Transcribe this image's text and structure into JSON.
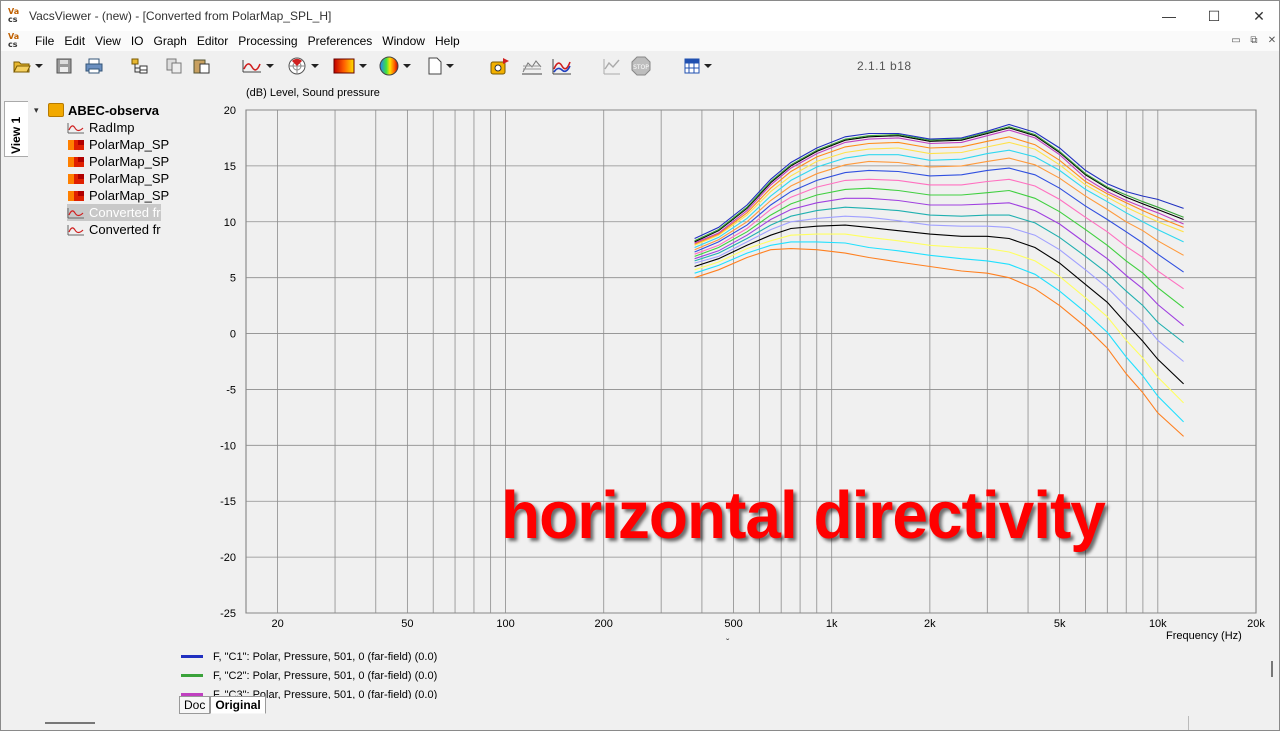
{
  "window": {
    "title": "VacsViewer - (new) - [Converted from PolarMap_SPL_H]",
    "logo_top": "Va",
    "logo_bottom": "cs",
    "minimize_glyph": "—",
    "maximize_glyph": "☐",
    "close_glyph": "✕"
  },
  "menu": {
    "items": [
      "File",
      "Edit",
      "View",
      "IO",
      "Graph",
      "Editor",
      "Processing",
      "Preferences",
      "Window",
      "Help"
    ],
    "mdi_minimize": "▭",
    "mdi_restore": "⧉",
    "mdi_close": "✕"
  },
  "toolbar": {
    "version": "2.1.1 b18",
    "icons": [
      "open-folder-icon",
      "save-icon",
      "print-icon",
      "tree-icon",
      "copy-icon",
      "paste-icon",
      "line-graph-icon",
      "polar-icon",
      "colormap-icon",
      "sphere-icon",
      "document-icon",
      "run-icon",
      "waterfall-icon",
      "graph-compare-icon",
      "graph-disabled-icon",
      "stop-icon",
      "grid-icon"
    ]
  },
  "sidebar": {
    "view_tab": "View 1",
    "root": {
      "label": "ABEC-observa",
      "toggle": "▾"
    },
    "items": [
      {
        "label": "RadImp",
        "kind": "line",
        "dim": false
      },
      {
        "label": "PolarMap_SP",
        "kind": "map",
        "dim": false
      },
      {
        "label": "PolarMap_SP",
        "kind": "map",
        "dim": false
      },
      {
        "label": "PolarMap_SP",
        "kind": "map",
        "dim": false
      },
      {
        "label": "PolarMap_SP",
        "kind": "map",
        "dim": false
      },
      {
        "label": "Converted fr",
        "kind": "line",
        "dim": true
      },
      {
        "label": "Converted fr",
        "kind": "line",
        "dim": false
      }
    ]
  },
  "graph": {
    "ylabel": "(dB)  Level, Sound pressure",
    "xlabel": "Frequency  (Hz)",
    "overlay_text": "horizontal directivity",
    "sort_glyph": "ˇ"
  },
  "chart_data": {
    "type": "line",
    "title": "",
    "xlabel": "Frequency  (Hz)",
    "ylabel": "(dB)  Level, Sound pressure",
    "xscale": "log",
    "xlim": [
      16,
      20000
    ],
    "ylim": [
      -25,
      20
    ],
    "grid": true,
    "x_tick_labels": [
      "20",
      "50",
      "100",
      "200",
      "500",
      "1k",
      "2k",
      "5k",
      "10k",
      "20k"
    ],
    "x_tick_values": [
      20,
      50,
      100,
      200,
      500,
      1000,
      2000,
      5000,
      10000,
      20000
    ],
    "y_ticks": [
      -25,
      -20,
      -15,
      -10,
      -5,
      0,
      5,
      10,
      15,
      20
    ],
    "x": [
      380,
      450,
      550,
      650,
      750,
      900,
      1100,
      1300,
      1600,
      2000,
      2500,
      3000,
      3500,
      4200,
      5000,
      6000,
      7000,
      8000,
      9000,
      10000,
      12000
    ],
    "series": [
      {
        "name": "F, \"C1\": Polar, Pressure, 501, 0 (far-field) (0.0)",
        "color": "#2030c0",
        "values": [
          8.5,
          9.5,
          11.5,
          13.8,
          15.3,
          16.6,
          17.6,
          17.9,
          17.9,
          17.4,
          17.5,
          18.1,
          18.7,
          18.0,
          16.6,
          14.6,
          13.4,
          12.7,
          12.3,
          12.0,
          11.2
        ]
      },
      {
        "name": "F, \"C2\": Polar, Pressure, 501, 0 (far-field) (0.0)",
        "color": "#3aa23a",
        "values": [
          8.3,
          9.3,
          11.3,
          13.6,
          15.1,
          16.4,
          17.4,
          17.7,
          17.8,
          17.3,
          17.4,
          18.0,
          18.5,
          17.8,
          16.3,
          14.3,
          13.1,
          12.4,
          11.8,
          11.3,
          10.4
        ]
      },
      {
        "name": "F, \"C3\": Polar, Pressure, 501, 0 (far-field) (0.0)",
        "color": "#c040c0",
        "values": [
          8.1,
          9.0,
          11.0,
          13.3,
          14.8,
          16.1,
          17.1,
          17.4,
          17.5,
          17.0,
          17.1,
          17.7,
          18.2,
          17.5,
          16.0,
          13.9,
          12.7,
          11.9,
          11.3,
          10.8,
          9.8
        ]
      }
    ],
    "extra_curves": [
      {
        "color": "#000000",
        "values": [
          8.2,
          9.2,
          11.2,
          13.5,
          15.0,
          16.3,
          17.3,
          17.6,
          17.7,
          17.2,
          17.3,
          17.9,
          18.4,
          17.7,
          16.2,
          14.2,
          13.0,
          12.2,
          11.6,
          11.1,
          10.2
        ]
      },
      {
        "color": "#ff8c1a",
        "values": [
          8.0,
          8.9,
          10.8,
          13.0,
          14.5,
          15.8,
          16.7,
          17.0,
          17.1,
          16.6,
          16.7,
          17.2,
          17.6,
          16.9,
          15.5,
          13.6,
          12.5,
          11.7,
          11.0,
          10.4,
          9.5
        ]
      },
      {
        "color": "#ffe24a",
        "values": [
          7.9,
          8.8,
          10.6,
          12.7,
          14.1,
          15.4,
          16.2,
          16.5,
          16.6,
          16.1,
          16.2,
          16.7,
          17.1,
          16.5,
          15.1,
          13.3,
          12.2,
          11.3,
          10.6,
          10.0,
          9.1
        ]
      },
      {
        "color": "#30d8f0",
        "values": [
          7.7,
          8.6,
          10.3,
          12.3,
          13.7,
          14.9,
          15.7,
          16.0,
          16.0,
          15.5,
          15.6,
          16.1,
          16.4,
          15.8,
          14.6,
          12.9,
          11.8,
          10.8,
          10.0,
          9.3,
          8.2
        ]
      },
      {
        "color": "#ff9a3c",
        "values": [
          7.5,
          8.4,
          10.0,
          11.9,
          13.2,
          14.3,
          15.1,
          15.4,
          15.3,
          14.9,
          15.0,
          15.4,
          15.7,
          15.1,
          13.9,
          12.3,
          11.1,
          10.0,
          9.2,
          8.3,
          7.0
        ]
      },
      {
        "color": "#3050e0",
        "values": [
          7.3,
          8.2,
          9.7,
          11.5,
          12.7,
          13.7,
          14.4,
          14.6,
          14.5,
          14.1,
          14.2,
          14.6,
          14.8,
          14.2,
          13.0,
          11.4,
          10.2,
          9.1,
          8.1,
          7.1,
          5.5
        ]
      },
      {
        "color": "#ff70c0",
        "values": [
          7.1,
          7.9,
          9.4,
          11.1,
          12.2,
          13.1,
          13.7,
          13.8,
          13.7,
          13.3,
          13.3,
          13.6,
          13.8,
          13.2,
          12.0,
          10.4,
          9.1,
          7.8,
          6.8,
          5.6,
          4.0
        ]
      },
      {
        "color": "#40d040",
        "values": [
          6.9,
          7.7,
          9.1,
          10.6,
          11.6,
          12.4,
          12.9,
          13.0,
          12.8,
          12.4,
          12.4,
          12.6,
          12.8,
          12.1,
          10.9,
          9.3,
          7.9,
          6.5,
          5.4,
          4.1,
          2.3
        ]
      },
      {
        "color": "#a040e0",
        "values": [
          6.7,
          7.4,
          8.8,
          10.2,
          11.1,
          11.7,
          12.1,
          12.1,
          11.9,
          11.5,
          11.5,
          11.6,
          11.7,
          11.0,
          9.8,
          8.1,
          6.7,
          5.2,
          4.0,
          2.6,
          0.7
        ]
      },
      {
        "color": "#20b0b0",
        "values": [
          6.5,
          7.2,
          8.5,
          9.7,
          10.5,
          11.0,
          11.3,
          11.2,
          11.0,
          10.6,
          10.5,
          10.6,
          10.6,
          9.9,
          8.6,
          6.9,
          5.4,
          3.8,
          2.5,
          1.0,
          -0.8
        ]
      },
      {
        "color": "#a0a0ff",
        "values": [
          6.3,
          6.9,
          8.2,
          9.3,
          10.0,
          10.3,
          10.5,
          10.4,
          10.1,
          9.7,
          9.6,
          9.6,
          9.5,
          8.8,
          7.5,
          5.7,
          4.1,
          2.4,
          1.0,
          -0.6,
          -2.5
        ]
      },
      {
        "color": "#000000",
        "values": [
          6.0,
          6.7,
          7.9,
          8.8,
          9.4,
          9.6,
          9.7,
          9.5,
          9.2,
          8.9,
          8.7,
          8.7,
          8.5,
          7.7,
          6.3,
          4.4,
          2.8,
          0.9,
          -0.7,
          -2.3,
          -4.5
        ]
      },
      {
        "color": "#ffff60",
        "values": [
          5.7,
          6.4,
          7.6,
          8.3,
          8.8,
          8.9,
          8.9,
          8.6,
          8.3,
          7.9,
          7.7,
          7.6,
          7.3,
          6.5,
          5.1,
          3.2,
          1.5,
          -0.6,
          -2.2,
          -3.9,
          -6.2
        ]
      },
      {
        "color": "#20e0ff",
        "values": [
          5.4,
          6.1,
          7.2,
          7.9,
          8.2,
          8.2,
          8.1,
          7.7,
          7.4,
          7.0,
          6.7,
          6.5,
          6.2,
          5.3,
          3.8,
          1.9,
          0.1,
          -2.1,
          -3.8,
          -5.6,
          -7.9
        ]
      },
      {
        "color": "#ff8020",
        "values": [
          5.0,
          5.7,
          6.8,
          7.5,
          7.6,
          7.5,
          7.2,
          6.8,
          6.4,
          6.0,
          5.6,
          5.4,
          5.0,
          4.0,
          2.5,
          0.6,
          -1.3,
          -3.6,
          -5.3,
          -7.1,
          -9.2
        ]
      }
    ]
  },
  "legend": [
    {
      "label": "F, \"C1\": Polar, Pressure, 501, 0 (far-field) (0.0)",
      "color": "#2030c0"
    },
    {
      "label": "F, \"C2\": Polar, Pressure, 501, 0 (far-field) (0.0)",
      "color": "#3aa23a"
    },
    {
      "label": "F, \"C3\": Polar, Pressure, 501, 0 (far-field) (0.0)",
      "color": "#c040c0"
    }
  ],
  "bottom_tabs": [
    {
      "label": "Doc",
      "active": false
    },
    {
      "label": "Original",
      "active": true
    }
  ]
}
